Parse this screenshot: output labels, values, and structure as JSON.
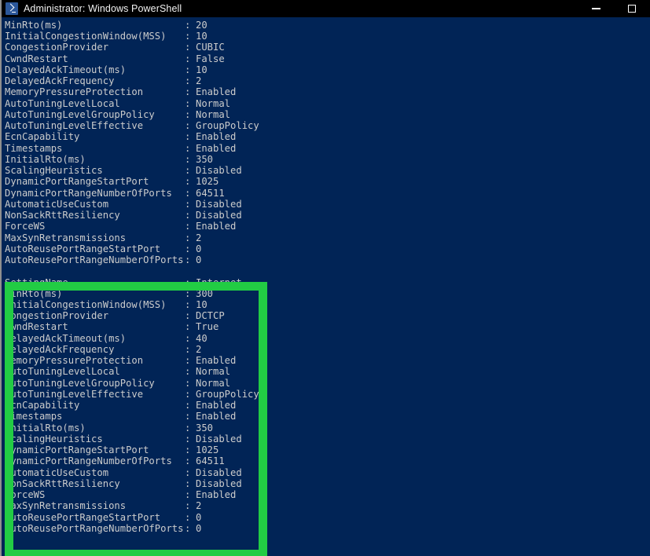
{
  "window": {
    "title": "Administrator: Windows PowerShell",
    "icon": "powershell-icon",
    "controls": {
      "minimize_label": "Minimize",
      "maximize_label": "Maximize"
    }
  },
  "theme": {
    "console_background": "#012456",
    "console_foreground": "#cccccc",
    "titlebar_background": "#000000",
    "titlebar_foreground": "#f2f2f2",
    "highlight_color": "#22cc44"
  },
  "console": {
    "blocks": [
      {
        "id": "block-datacenter-custom",
        "highlighted": false,
        "rows": [
          {
            "key": "MinRto(ms)",
            "colon": ":",
            "value": "20"
          },
          {
            "key": "InitialCongestionWindow(MSS)",
            "colon": ":",
            "value": "10"
          },
          {
            "key": "CongestionProvider",
            "colon": ":",
            "value": "CUBIC"
          },
          {
            "key": "CwndRestart",
            "colon": ":",
            "value": "False"
          },
          {
            "key": "DelayedAckTimeout(ms)",
            "colon": ":",
            "value": "10"
          },
          {
            "key": "DelayedAckFrequency",
            "colon": ":",
            "value": "2"
          },
          {
            "key": "MemoryPressureProtection",
            "colon": ":",
            "value": "Enabled"
          },
          {
            "key": "AutoTuningLevelLocal",
            "colon": ":",
            "value": "Normal"
          },
          {
            "key": "AutoTuningLevelGroupPolicy",
            "colon": ":",
            "value": "Normal"
          },
          {
            "key": "AutoTuningLevelEffective",
            "colon": ":",
            "value": "GroupPolicy"
          },
          {
            "key": "EcnCapability",
            "colon": ":",
            "value": "Enabled"
          },
          {
            "key": "Timestamps",
            "colon": ":",
            "value": "Enabled"
          },
          {
            "key": "InitialRto(ms)",
            "colon": ":",
            "value": "350"
          },
          {
            "key": "ScalingHeuristics",
            "colon": ":",
            "value": "Disabled"
          },
          {
            "key": "DynamicPortRangeStartPort",
            "colon": ":",
            "value": "1025"
          },
          {
            "key": "DynamicPortRangeNumberOfPorts",
            "colon": ":",
            "value": "64511"
          },
          {
            "key": "AutomaticUseCustom",
            "colon": ":",
            "value": "Disabled"
          },
          {
            "key": "NonSackRttResiliency",
            "colon": ":",
            "value": "Disabled"
          },
          {
            "key": "ForceWS",
            "colon": ":",
            "value": "Enabled"
          },
          {
            "key": "MaxSynRetransmissions",
            "colon": ":",
            "value": "2"
          },
          {
            "key": "AutoReusePortRangeStartPort",
            "colon": ":",
            "value": "0"
          },
          {
            "key": "AutoReusePortRangeNumberOfPorts",
            "colon": ":",
            "value": "0"
          }
        ]
      },
      {
        "id": "block-internet",
        "highlighted": true,
        "rows": [
          {
            "key": "SettingName",
            "colon": ":",
            "value": "Internet"
          },
          {
            "key": "MinRto(ms)",
            "colon": ":",
            "value": "300"
          },
          {
            "key": "InitialCongestionWindow(MSS)",
            "colon": ":",
            "value": "10"
          },
          {
            "key": "CongestionProvider",
            "colon": ":",
            "value": "DCTCP"
          },
          {
            "key": "CwndRestart",
            "colon": ":",
            "value": "True"
          },
          {
            "key": "DelayedAckTimeout(ms)",
            "colon": ":",
            "value": "40"
          },
          {
            "key": "DelayedAckFrequency",
            "colon": ":",
            "value": "2"
          },
          {
            "key": "MemoryPressureProtection",
            "colon": ":",
            "value": "Enabled"
          },
          {
            "key": "AutoTuningLevelLocal",
            "colon": ":",
            "value": "Normal"
          },
          {
            "key": "AutoTuningLevelGroupPolicy",
            "colon": ":",
            "value": "Normal"
          },
          {
            "key": "AutoTuningLevelEffective",
            "colon": ":",
            "value": "GroupPolicy"
          },
          {
            "key": "EcnCapability",
            "colon": ":",
            "value": "Enabled"
          },
          {
            "key": "Timestamps",
            "colon": ":",
            "value": "Enabled"
          },
          {
            "key": "InitialRto(ms)",
            "colon": ":",
            "value": "350"
          },
          {
            "key": "ScalingHeuristics",
            "colon": ":",
            "value": "Disabled"
          },
          {
            "key": "DynamicPortRangeStartPort",
            "colon": ":",
            "value": "1025"
          },
          {
            "key": "DynamicPortRangeNumberOfPorts",
            "colon": ":",
            "value": "64511"
          },
          {
            "key": "AutomaticUseCustom",
            "colon": ":",
            "value": "Disabled"
          },
          {
            "key": "NonSackRttResiliency",
            "colon": ":",
            "value": "Disabled"
          },
          {
            "key": "ForceWS",
            "colon": ":",
            "value": "Enabled"
          },
          {
            "key": "MaxSynRetransmissions",
            "colon": ":",
            "value": "2"
          },
          {
            "key": "AutoReusePortRangeStartPort",
            "colon": ":",
            "value": "0"
          },
          {
            "key": "AutoReusePortRangeNumberOfPorts",
            "colon": ":",
            "value": "0"
          }
        ]
      }
    ]
  }
}
